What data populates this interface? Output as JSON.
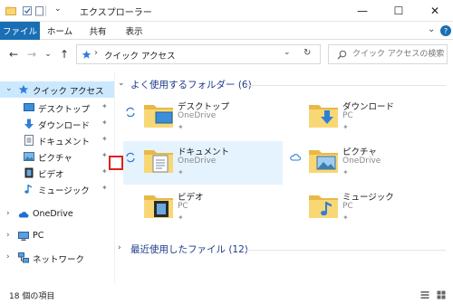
{
  "window": {
    "title": "エクスプローラー",
    "minimize_glyph": "—",
    "maximize_glyph": "☐",
    "close_glyph": "✕"
  },
  "ribbon": {
    "tabs": [
      "ファイル",
      "ホーム",
      "共有",
      "表示"
    ],
    "file_color": "#1a6fb4",
    "collapse_glyph": "⌄",
    "help_glyph": "?"
  },
  "nav": {
    "back_glyph": "←",
    "forward_glyph": "→",
    "recent_glyph": "⌄",
    "up_glyph": "↑",
    "address_text": "クイック アクセス",
    "address_sep": "›",
    "address_dropdown_glyph": "⌄",
    "refresh_glyph": "↻",
    "search_placeholder": "クイック アクセスの検索"
  },
  "sidebar": {
    "quick_access": {
      "label": "クイック アクセス",
      "chevron": "⌄"
    },
    "pinned": [
      {
        "label": "デスクトップ",
        "icon": "desktop-icon"
      },
      {
        "label": "ダウンロード",
        "icon": "download-icon"
      },
      {
        "label": "ドキュメント",
        "icon": "document-icon"
      },
      {
        "label": "ピクチャ",
        "icon": "picture-icon"
      },
      {
        "label": "ビデオ",
        "icon": "video-icon"
      },
      {
        "label": "ミュージック",
        "icon": "music-icon"
      }
    ],
    "pin_glyph": "✦",
    "roots": [
      {
        "label": "OneDrive",
        "icon": "onedrive-icon",
        "chevron": "›"
      },
      {
        "label": "PC",
        "icon": "pc-icon",
        "chevron": "›"
      },
      {
        "label": "ネットワーク",
        "icon": "network-icon",
        "chevron": "›"
      }
    ]
  },
  "main": {
    "frequent": {
      "chevron": "⌄",
      "label": "よく使用するフォルダー (6)"
    },
    "recent": {
      "chevron": "›",
      "label": "最近使用したファイル (12)"
    },
    "folders": [
      {
        "name": "デスクトップ",
        "location": "OneDrive",
        "status": "sync"
      },
      {
        "name": "ダウンロード",
        "location": "PC",
        "status": ""
      },
      {
        "name": "ドキュメント",
        "location": "OneDrive",
        "status": "sync"
      },
      {
        "name": "ピクチャ",
        "location": "OneDrive",
        "status": "cloud"
      },
      {
        "name": "ビデオ",
        "location": "PC",
        "status": ""
      },
      {
        "name": "ミュージック",
        "location": "PC",
        "status": ""
      }
    ],
    "pin_glyph": "✦"
  },
  "status": {
    "item_count": "18 個の項目"
  },
  "colors": {
    "accent": "#1a6fb4",
    "folder": "#f8d775",
    "folder_dark": "#e8b948",
    "selected": "#cce8ff",
    "hover": "#e5f3ff",
    "highlight_box": "#e0201a"
  }
}
